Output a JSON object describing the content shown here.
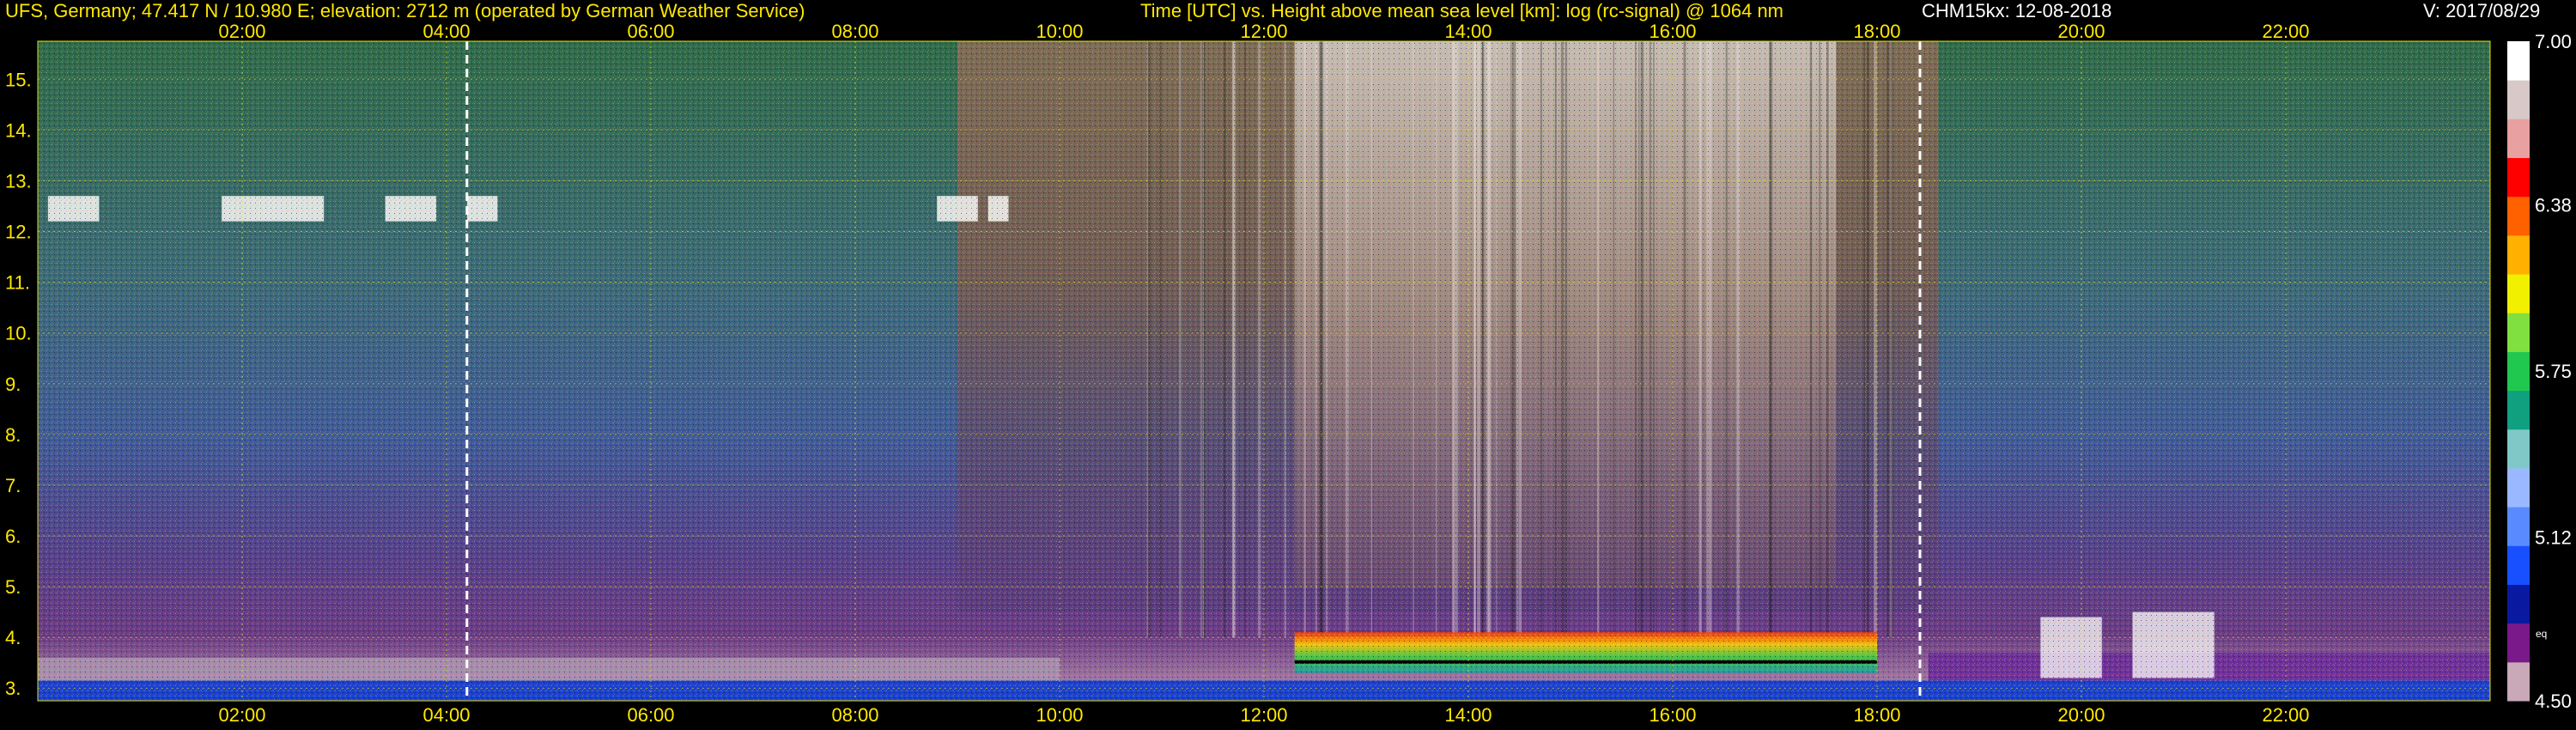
{
  "header": {
    "station_text": "UFS, Germany; 47.417 N / 10.980 E; elevation: 2712 m  (operated by German Weather Service)",
    "title_text": "Time [UTC] vs. Height above mean sea level [km]: log (rc-signal) @ 1064 nm",
    "instrument_text": "CHM15kx: 12-08-2018",
    "version_text": "V: 2017/08/29"
  },
  "chart_data": {
    "type": "heatmap",
    "title": "Time [UTC] vs. Height above mean sea level [km]: log (rc-signal) @ 1064 nm",
    "xlabel": "Time [UTC]",
    "ylabel": "Height above mean sea level [km]",
    "x_range_hours": [
      0.0,
      24.0
    ],
    "y_range_km": [
      2.75,
      15.75
    ],
    "x_ticks": [
      "02:00",
      "04:00",
      "06:00",
      "08:00",
      "10:00",
      "12:00",
      "14:00",
      "16:00",
      "18:00",
      "20:00",
      "22:00"
    ],
    "x_tick_hours": [
      2,
      4,
      6,
      8,
      10,
      12,
      14,
      16,
      18,
      20,
      22
    ],
    "y_ticks": [
      "3.",
      "4.",
      "5.",
      "6.",
      "7.",
      "8.",
      "9.",
      "10.",
      "11.",
      "12.",
      "13.",
      "14.",
      "15."
    ],
    "y_tick_values": [
      3,
      4,
      5,
      6,
      7,
      8,
      9,
      10,
      11,
      12,
      13,
      14,
      15
    ],
    "grid": true,
    "markers_hours": [
      4.2,
      18.42
    ],
    "colorbar": {
      "min": 4.5,
      "max": 7.0,
      "labels": [
        "7.00",
        "6.38",
        "5.75",
        "5.12",
        "4.50"
      ],
      "label_values": [
        7.0,
        6.38,
        5.75,
        5.12,
        4.5
      ],
      "colors": [
        "#c9a8b8",
        "#7a1a8a",
        "#0a1aa0",
        "#1850ff",
        "#5a8aff",
        "#9ab8ff",
        "#80c8c8",
        "#10a080",
        "#20c850",
        "#80e040",
        "#f0f000",
        "#ffb000",
        "#ff6000",
        "#ff0000",
        "#e8a0a0",
        "#d8c8c8",
        "#ffffff"
      ],
      "unit": "eq"
    },
    "features": {
      "cloud_layer_top_km": 4.1,
      "high_cloud_km": 12.4
    }
  }
}
